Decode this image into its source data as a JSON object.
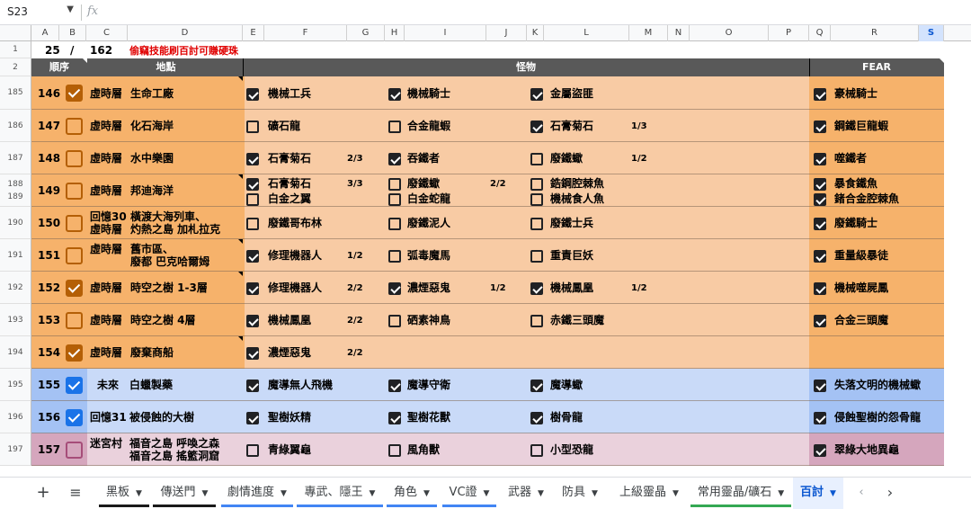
{
  "formula_bar": {
    "cell_ref": "S23",
    "fx": "fx"
  },
  "columns": [
    "A",
    "B",
    "C",
    "D",
    "E",
    "F",
    "G",
    "H",
    "I",
    "J",
    "K",
    "L",
    "M",
    "N",
    "O",
    "P",
    "Q",
    "R",
    "S"
  ],
  "row1": {
    "rownum": "1",
    "progress_done": "25",
    "slash": "/",
    "progress_total": "162",
    "tip": "偷竊技能刷百討可賺硬珠"
  },
  "row2": {
    "rownum": "2",
    "col_order": "順序",
    "col_place": "地點",
    "col_monster": "怪物",
    "col_fear": "FEAR"
  },
  "rows": [
    {
      "rn": "185",
      "num": "146",
      "done": true,
      "place": [
        [
          "虛時層",
          "生命工廠"
        ]
      ],
      "m": [
        {
          "name": "機械工兵",
          "checked": true,
          "count": ""
        },
        {
          "name": "機械騎士",
          "checked": true,
          "count": ""
        },
        {
          "name": "金屬盜匪",
          "checked": true,
          "count": ""
        }
      ],
      "fear": [
        {
          "name": "豪械騎士",
          "checked": true
        }
      ],
      "color": "orange"
    },
    {
      "rn": "186",
      "num": "147",
      "done": false,
      "place": [
        [
          "虛時層",
          "化石海岸"
        ]
      ],
      "m": [
        {
          "name": "礦石龍",
          "checked": false,
          "count": ""
        },
        {
          "name": "合金龍蝦",
          "checked": false,
          "count": ""
        },
        {
          "name": "石膏菊石",
          "checked": true,
          "count": "1/3"
        }
      ],
      "fear": [
        {
          "name": "鋼鐵巨龍蝦",
          "checked": true
        }
      ],
      "color": "orange"
    },
    {
      "rn": "187",
      "num": "148",
      "done": false,
      "place": [
        [
          "虛時層",
          "水中樂園"
        ]
      ],
      "m": [
        {
          "name": "石膏菊石",
          "checked": true,
          "count": "2/3"
        },
        {
          "name": "吞鐵者",
          "checked": true,
          "count": ""
        },
        {
          "name": "廢鐵蠍",
          "checked": false,
          "count": "1/2"
        }
      ],
      "fear": [
        {
          "name": "噬鐵者",
          "checked": true
        }
      ],
      "color": "orange"
    },
    {
      "rn": "188",
      "rn2": "189",
      "num": "149",
      "done": false,
      "place": [
        [
          "虛時層",
          "邦迪海洋"
        ]
      ],
      "m": [
        {
          "name": "石膏菊石",
          "checked": true,
          "count": "3/3"
        },
        {
          "name": "廢鐵蠍",
          "checked": false,
          "count": "2/2"
        },
        {
          "name": "鋯鋼腔棘魚",
          "checked": false,
          "count": ""
        }
      ],
      "m2": [
        {
          "name": "白金之翼",
          "checked": false,
          "count": ""
        },
        {
          "name": "白金蛇龍",
          "checked": false,
          "count": ""
        },
        {
          "name": "機械食人魚",
          "checked": false,
          "count": ""
        }
      ],
      "fear": [
        {
          "name": "暴食鐵魚",
          "checked": true
        },
        {
          "name": "鍺合金腔棘魚",
          "checked": true
        }
      ],
      "color": "orange"
    },
    {
      "rn": "190",
      "num": "150",
      "done": false,
      "place": [
        [
          "回憶30",
          "橫渡大海列車、"
        ],
        [
          "虛時層",
          "灼熱之島 加札拉克"
        ]
      ],
      "m": [
        {
          "name": "廢鐵哥布林",
          "checked": false,
          "count": ""
        },
        {
          "name": "廢鐵泥人",
          "checked": false,
          "count": ""
        },
        {
          "name": "廢鐵士兵",
          "checked": false,
          "count": ""
        }
      ],
      "fear": [
        {
          "name": "廢鐵騎士",
          "checked": true
        }
      ],
      "color": "orange"
    },
    {
      "rn": "191",
      "num": "151",
      "done": false,
      "place": [
        [
          "虛時層",
          "舊市區、"
        ],
        [
          "",
          "廢都 巴克哈爾姆"
        ]
      ],
      "m": [
        {
          "name": "修理機器人",
          "checked": true,
          "count": "1/2"
        },
        {
          "name": "弧毒魔馬",
          "checked": false,
          "count": ""
        },
        {
          "name": "重責巨妖",
          "checked": false,
          "count": ""
        }
      ],
      "fear": [
        {
          "name": "重量級暴徒",
          "checked": true
        }
      ],
      "color": "orange"
    },
    {
      "rn": "192",
      "num": "152",
      "done": true,
      "place": [
        [
          "虛時層",
          "時空之樹 1-3層"
        ]
      ],
      "m": [
        {
          "name": "修理機器人",
          "checked": true,
          "count": "2/2"
        },
        {
          "name": "濃煙惡鬼",
          "checked": true,
          "count": "1/2"
        },
        {
          "name": "機械鳳凰",
          "checked": true,
          "count": "1/2"
        }
      ],
      "fear": [
        {
          "name": "機械噬屍鳳",
          "checked": true
        }
      ],
      "color": "orange"
    },
    {
      "rn": "193",
      "num": "153",
      "done": false,
      "place": [
        [
          "虛時層",
          "時空之樹 4層"
        ]
      ],
      "m": [
        {
          "name": "機械鳳凰",
          "checked": true,
          "count": "2/2"
        },
        {
          "name": "硒素神鳥",
          "checked": false,
          "count": ""
        },
        {
          "name": "赤鐵三頭魔",
          "checked": false,
          "count": ""
        }
      ],
      "fear": [
        {
          "name": "合金三頭魔",
          "checked": true
        }
      ],
      "color": "orange"
    },
    {
      "rn": "194",
      "num": "154",
      "done": true,
      "place": [
        [
          "虛時層",
          "廢棄商船"
        ]
      ],
      "m": [
        {
          "name": "濃煙惡鬼",
          "checked": true,
          "count": "2/2"
        }
      ],
      "fear": [],
      "color": "orange"
    },
    {
      "rn": "195",
      "num": "155",
      "done": true,
      "place": [
        [
          "未來",
          "白蠟製藥"
        ]
      ],
      "m": [
        {
          "name": "魔導無人飛機",
          "checked": true,
          "count": ""
        },
        {
          "name": "魔導守衛",
          "checked": true,
          "count": ""
        },
        {
          "name": "魔導蠍",
          "checked": true,
          "count": ""
        }
      ],
      "fear": [
        {
          "name": "失落文明的機械蠍",
          "checked": true
        }
      ],
      "color": "blue"
    },
    {
      "rn": "196",
      "num": "156",
      "done": true,
      "place": [
        [
          "回憶31",
          "被侵蝕的大樹"
        ]
      ],
      "m": [
        {
          "name": "聖樹妖精",
          "checked": true,
          "count": ""
        },
        {
          "name": "聖樹花獸",
          "checked": true,
          "count": ""
        },
        {
          "name": "樹骨龍",
          "checked": true,
          "count": ""
        }
      ],
      "fear": [
        {
          "name": "侵蝕聖樹的怨骨龍",
          "checked": true
        }
      ],
      "color": "blue"
    },
    {
      "rn": "197",
      "num": "157",
      "done": false,
      "place": [
        [
          "迷宮村",
          "福音之島 呼喚之森"
        ],
        [
          "",
          "福音之島 搖籃洞窟"
        ]
      ],
      "m": [
        {
          "name": "青綠翼龜",
          "checked": false,
          "count": ""
        },
        {
          "name": "風角獸",
          "checked": false,
          "count": ""
        },
        {
          "name": "小型恐龍",
          "checked": false,
          "count": ""
        }
      ],
      "fear": [
        {
          "name": "翠綠大地異龜",
          "checked": true
        }
      ],
      "color": "pink"
    }
  ],
  "tabs": [
    {
      "label": "黑板",
      "underline": "#1a1a1a"
    },
    {
      "label": "傳送門",
      "underline": "#1a1a1a"
    },
    {
      "label": "劇情進度",
      "underline": "#4285f4"
    },
    {
      "label": "專武、隱王",
      "underline": "#4285f4"
    },
    {
      "label": "角色",
      "underline": "#4285f4"
    },
    {
      "label": "VC證",
      "underline": "#4285f4"
    },
    {
      "label": "武器",
      "underline": ""
    },
    {
      "label": "防具",
      "underline": ""
    },
    {
      "label": "上級靈晶",
      "underline": ""
    },
    {
      "label": "常用靈晶/礦石",
      "underline": "#34a853"
    },
    {
      "label": "百討",
      "underline": "",
      "active": true
    }
  ],
  "colors": {
    "orange_main": "#f8cba4",
    "orange_dark": "#f6b26b",
    "blue_main": "#c9daf8",
    "blue_dark": "#a4c2f4",
    "pink_main": "#ead1dc",
    "pink_dark": "#d5a6bd",
    "header_dark": "#595959",
    "check_orange": "#b45f06",
    "check_blue": "#1a73e8",
    "check_pink": "#a64d79",
    "red_text": "#e00000"
  }
}
